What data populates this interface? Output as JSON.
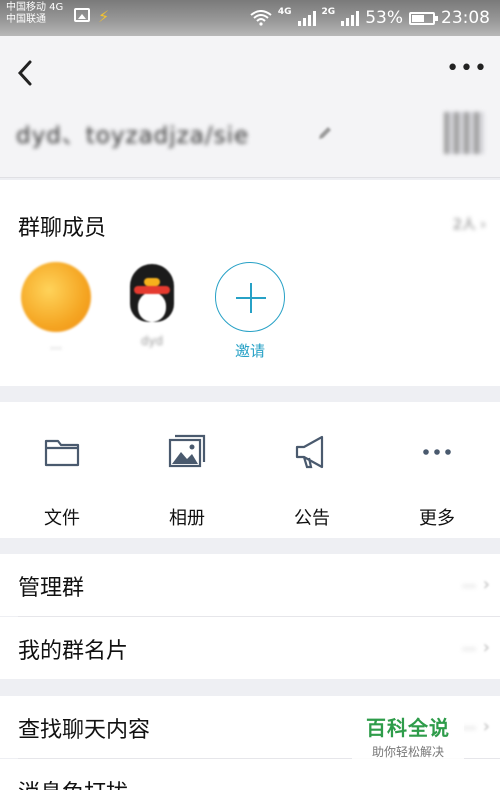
{
  "status_bar": {
    "carrier_1": "中国移动 4G",
    "carrier_2": "中国联通",
    "net_1": "4G",
    "net_2": "2G",
    "battery": "53%",
    "time": "23:08"
  },
  "header": {
    "group_name": "dyd、toyzadjza/sie"
  },
  "members": {
    "title": "群聊成员",
    "count_label": "2人",
    "list": [
      {
        "name": "…",
        "avatar": "orange-avatar"
      },
      {
        "name": "dyd",
        "avatar": "penguin-avatar"
      }
    ],
    "invite_label": "邀请"
  },
  "tools": [
    {
      "label": "文件",
      "icon": "folder-icon"
    },
    {
      "label": "相册",
      "icon": "photo-album-icon"
    },
    {
      "label": "公告",
      "icon": "megaphone-icon"
    },
    {
      "label": "更多",
      "icon": "more-dots-icon"
    }
  ],
  "list": [
    {
      "label": "管理群",
      "value": "…"
    },
    {
      "label": "我的群名片",
      "value": "…"
    },
    {
      "label": "查找聊天内容",
      "value": "…"
    },
    {
      "label": "消息免打扰",
      "value": ""
    }
  ],
  "watermark": {
    "title": "百科全说",
    "subtitle": "助你轻松解决"
  },
  "colors": {
    "accent": "#27a1c6",
    "watermark_green": "#2e9c4a"
  }
}
